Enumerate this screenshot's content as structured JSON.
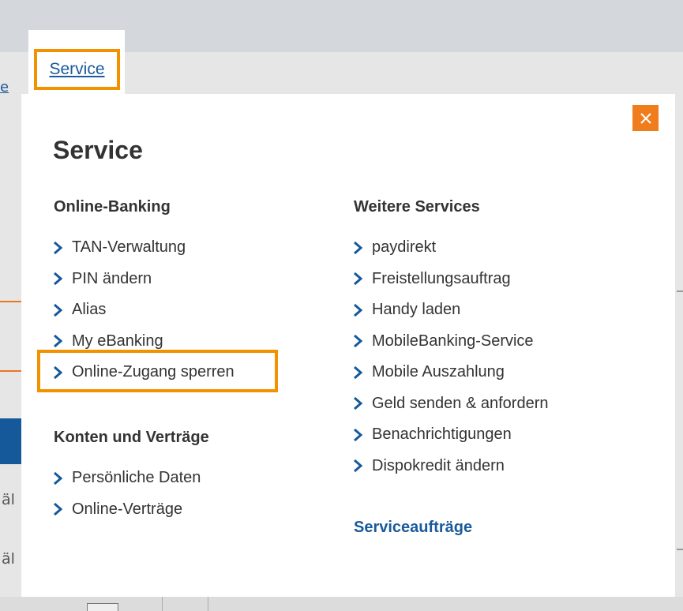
{
  "background": {
    "link_fragment": "e",
    "text_fragment_1": "äl",
    "text_fragment_2": "äl"
  },
  "tab": {
    "label": "Service"
  },
  "modal": {
    "title": "Service",
    "close_icon": "close-icon",
    "online_banking": {
      "heading": "Online-Banking",
      "items": [
        {
          "label": "TAN-Verwaltung"
        },
        {
          "label": "PIN ändern"
        },
        {
          "label": "Alias"
        },
        {
          "label": "My eBanking"
        },
        {
          "label": "Online-Zugang sperren"
        }
      ]
    },
    "konten": {
      "heading": "Konten und Verträge",
      "items": [
        {
          "label": "Persönliche Daten"
        },
        {
          "label": "Online-Verträge"
        }
      ]
    },
    "weitere": {
      "heading": "Weitere Services",
      "items": [
        {
          "label": "paydirekt"
        },
        {
          "label": "Freistellungsauftrag"
        },
        {
          "label": "Handy laden"
        },
        {
          "label": "MobileBanking-Service"
        },
        {
          "label": "Mobile Auszahlung"
        },
        {
          "label": "Geld senden & anfordern"
        },
        {
          "label": "Benachrichtigungen"
        },
        {
          "label": "Dispokredit ändern"
        }
      ]
    },
    "serviceauftraege": "Serviceaufträge"
  },
  "colors": {
    "accent_orange": "#f39200",
    "link_blue": "#1a5a9a",
    "chevron_blue": "#15599b"
  }
}
